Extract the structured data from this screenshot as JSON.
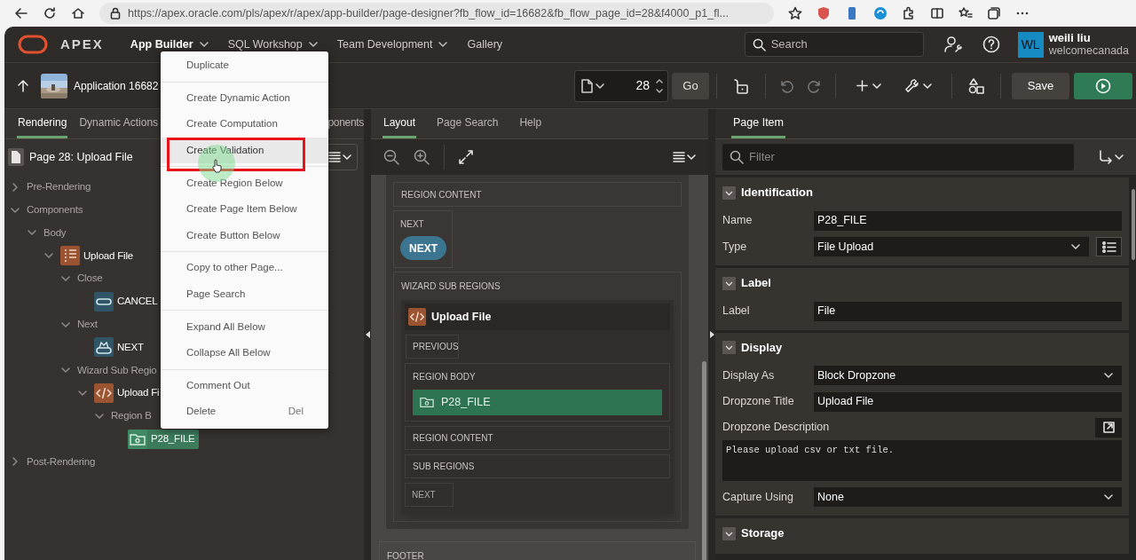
{
  "browser": {
    "url": "https://apex.oracle.com/pls/apex/r/apex/app-builder/page-designer?fb_flow_id=16682&fb_flow_page_id=28&f4000_p1_fl..."
  },
  "header": {
    "logo": "APEX",
    "nav": [
      {
        "label": "App Builder",
        "menu": true,
        "selected": true
      },
      {
        "label": "SQL Workshop",
        "menu": true,
        "selected": false
      },
      {
        "label": "Team Development",
        "menu": true,
        "selected": false
      },
      {
        "label": "Gallery",
        "menu": false,
        "selected": false
      }
    ],
    "search": {
      "placeholder": "Search"
    },
    "user": {
      "initials": "WL",
      "name": "weili liu",
      "workspace": "welcomecanada"
    }
  },
  "toolbar": {
    "app": "Application 16682",
    "page_number": "28",
    "go": "Go",
    "save": "Save"
  },
  "left_tabs": [
    {
      "label": "Rendering",
      "selected": true
    },
    {
      "label": "Dynamic Actions",
      "selected": false
    },
    {
      "label": "ponents",
      "selected": false
    }
  ],
  "tree": {
    "root": "Page 28: Upload File",
    "children": [
      {
        "label": "Pre-Rendering",
        "kind": "folder",
        "expanded": false,
        "selected": false
      },
      {
        "label": "Components",
        "kind": "folder",
        "expanded": true,
        "selected": false,
        "children": [
          {
            "label": "Body",
            "kind": "folder",
            "expanded": true,
            "selected": false,
            "children": [
              {
                "label": "Upload File",
                "kind": "region",
                "expanded": true,
                "selected": false,
                "children": [
                  {
                    "label": "Close",
                    "kind": "folder",
                    "expanded": true,
                    "selected": false,
                    "children": [
                      {
                        "label": "CANCEL",
                        "kind": "button",
                        "selected": false
                      }
                    ]
                  },
                  {
                    "label": "Next",
                    "kind": "folder",
                    "expanded": true,
                    "selected": false,
                    "children": [
                      {
                        "label": "NEXT",
                        "kind": "next-button",
                        "selected": false
                      }
                    ]
                  },
                  {
                    "label": "Wizard Sub Regio",
                    "kind": "folder",
                    "expanded": true,
                    "selected": false,
                    "children": [
                      {
                        "label": "Upload Fi",
                        "kind": "code-region",
                        "expanded": true,
                        "selected": false,
                        "children": [
                          {
                            "label": "Region B",
                            "kind": "folder",
                            "expanded": true,
                            "selected": false,
                            "children": [
                              {
                                "label": "P28_FILE",
                                "kind": "item",
                                "selected": true
                              }
                            ]
                          }
                        ]
                      }
                    ]
                  }
                ]
              }
            ]
          }
        ]
      },
      {
        "label": "Post-Rendering",
        "kind": "folder",
        "expanded": false,
        "selected": false
      }
    ]
  },
  "context_menu": {
    "groups": [
      [
        {
          "label": "Duplicate",
          "selected": false
        }
      ],
      [
        {
          "label": "Create Dynamic Action",
          "selected": false
        },
        {
          "label": "Create Computation",
          "selected": false
        },
        {
          "label": "Create Validation",
          "selected": true
        }
      ],
      [
        {
          "label": "Create Region Below",
          "selected": false
        },
        {
          "label": "Create Page Item Below",
          "selected": false
        },
        {
          "label": "Create Button Below",
          "selected": false
        }
      ],
      [
        {
          "label": "Copy to other Page...",
          "selected": false
        },
        {
          "label": "Page Search",
          "selected": false
        }
      ],
      [
        {
          "label": "Expand All Below",
          "selected": false
        },
        {
          "label": "Collapse All Below",
          "selected": false
        }
      ],
      [
        {
          "label": "Comment Out",
          "selected": false
        },
        {
          "label": "Delete",
          "selected": false,
          "shortcut": "Del"
        }
      ]
    ]
  },
  "layout": {
    "tabs": [
      {
        "label": "Layout",
        "selected": true
      },
      {
        "label": "Page Search",
        "selected": false
      },
      {
        "label": "Help",
        "selected": false
      }
    ],
    "region_content": "REGION CONTENT",
    "next_slot": "NEXT",
    "next_button": "NEXT",
    "wizard_label": "WIZARD SUB REGIONS",
    "region": {
      "title": "Upload File",
      "previous": "PREVIOUS",
      "body": "REGION BODY",
      "item": "P28_FILE",
      "content": "REGION CONTENT",
      "sub_regions": "SUB REGIONS",
      "next": "NEXT"
    },
    "footer": "FOOTER"
  },
  "property_editor": {
    "tab": "Page Item",
    "filter_placeholder": "Filter",
    "sections": [
      {
        "title": "Identification",
        "expanded": true,
        "fields": [
          {
            "label": "Name",
            "kind": "text",
            "value": "P28_FILE"
          },
          {
            "label": "Type",
            "kind": "select",
            "value": "File Upload",
            "list_button": true
          }
        ]
      },
      {
        "title": "Label",
        "expanded": true,
        "fields": [
          {
            "label": "Label",
            "kind": "text",
            "value": "File"
          }
        ]
      },
      {
        "title": "Display",
        "expanded": true,
        "fields": [
          {
            "label": "Display As",
            "kind": "select",
            "value": "Block Dropzone"
          },
          {
            "label": "Dropzone Title",
            "kind": "text",
            "value": "Upload File"
          },
          {
            "label": "Dropzone Description",
            "kind": "textarea",
            "value": "Please upload csv or txt file.",
            "expand_button": true
          },
          {
            "label": "Capture Using",
            "kind": "select",
            "value": "None"
          }
        ]
      },
      {
        "title": "Storage",
        "expanded": true
      }
    ]
  }
}
